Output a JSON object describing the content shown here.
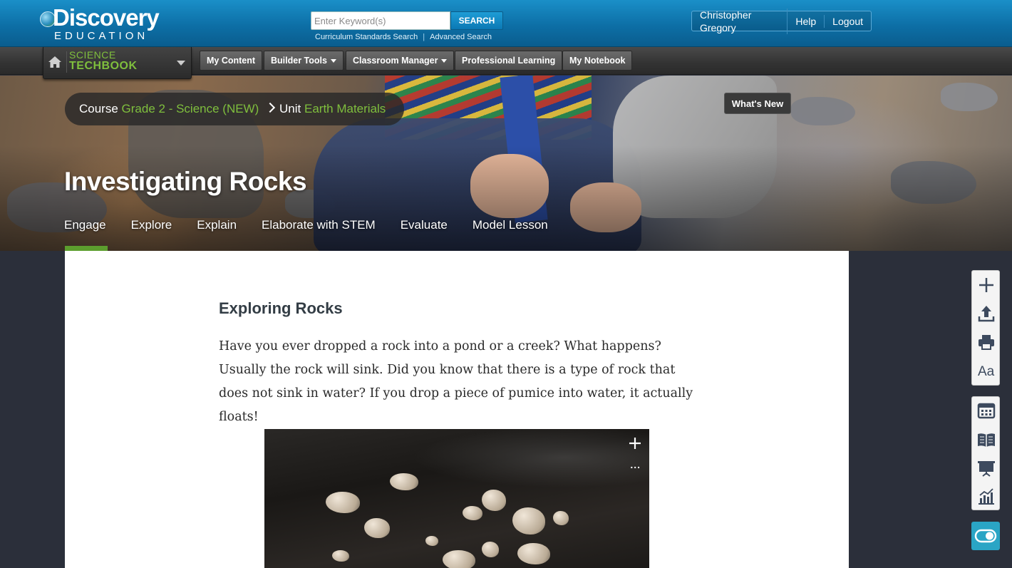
{
  "header": {
    "logo_main": "Discovery",
    "logo_sub": "EDUCATION",
    "search": {
      "placeholder": "Enter Keyword(s)",
      "button_label": "SEARCH",
      "link_standards": "Curriculum Standards Search",
      "link_advanced": "Advanced Search"
    },
    "user": {
      "name": "Christopher Gregory",
      "help": "Help",
      "logout": "Logout"
    }
  },
  "nav": {
    "product_line1": "SCIENCE",
    "product_line2": "TECHBOOK",
    "items": [
      {
        "label": "My Content"
      },
      {
        "label": "Builder Tools"
      },
      {
        "label": "Classroom Manager"
      },
      {
        "label": "Professional Learning"
      },
      {
        "label": "My Notebook"
      }
    ]
  },
  "hero": {
    "breadcrumb": {
      "course_label": "Course",
      "course_value": "Grade 2 - Science (NEW)",
      "unit_label": "Unit",
      "unit_value": "Earth Materials"
    },
    "whats_new": "What's New",
    "title": "Investigating Rocks",
    "tabs": [
      {
        "label": "Engage",
        "active": true
      },
      {
        "label": "Explore"
      },
      {
        "label": "Explain"
      },
      {
        "label": "Elaborate with STEM"
      },
      {
        "label": "Evaluate"
      },
      {
        "label": "Model Lesson"
      }
    ]
  },
  "content": {
    "section_title": "Exploring Rocks",
    "paragraph": "Have you ever dropped a rock into a pond or a creek? What happens? Usually the rock will sink. Did you know that there is a type of rock that does not sink in water? If you drop a piece of pumice into water, it actually floats!",
    "image_more": "..."
  },
  "sidebar_tools": {
    "group1": [
      "plus-icon",
      "upload-icon",
      "print-icon",
      "font-size-icon"
    ],
    "group1_text_icon": "Aa",
    "group2": [
      "calendar-icon",
      "book-icon",
      "presentation-icon",
      "chart-icon"
    ],
    "toggle": "toggle-icon"
  },
  "colors": {
    "header_blue": "#0d6fa6",
    "accent_green": "#7fbf3d",
    "tab_underline": "#5c9e2e",
    "toggle_teal": "#2aa5c5"
  }
}
